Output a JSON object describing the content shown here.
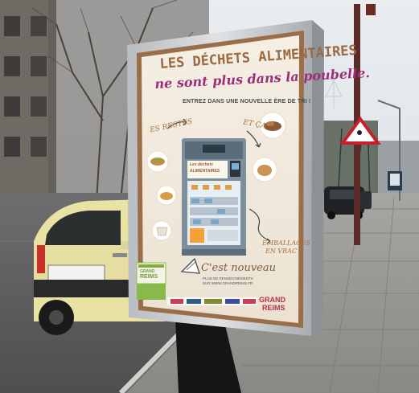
{
  "poster": {
    "title_line1": "LES DÉCHETS ALIMENTAIRES",
    "title_line2": "ne sont plus dans la poubelle.",
    "subtitle": "ENTREZ DANS UNE NOUVELLE ÈRE DE TRI !",
    "label_left": "ES RESTES",
    "label_right": "ET ÇA",
    "label_bottom_right_1": "EMBALLAGES",
    "label_bottom_right_2": "EN VRAC",
    "machine_line1": "Les déchets",
    "machine_line2": "ALIMENTAIRES",
    "cest_nouveau": "C'est nouveau",
    "info_line1": "PLUS DE RENSEIGNEMENTS",
    "info_line2": "SUR WWW.GRANDREIMS.FR",
    "grand": "GRAND",
    "reims": "REIMS",
    "badge_top": "GRAND",
    "badge_mid": "REIMS"
  }
}
